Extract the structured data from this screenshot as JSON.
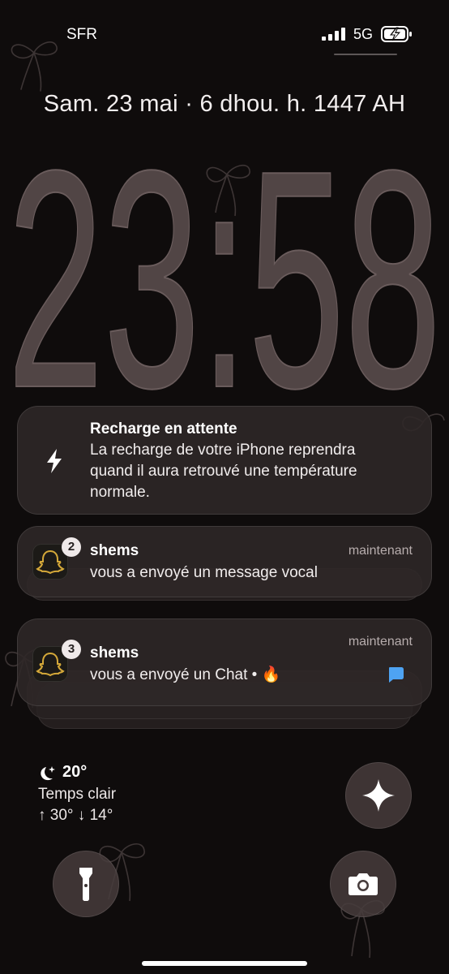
{
  "status_bar": {
    "carrier": "SFR",
    "network": "5G",
    "battery_state": "charging"
  },
  "lock": {
    "date": "Sam. 23 mai · 6 dhou. h. 1447 AH",
    "time": "23:58"
  },
  "notifications": [
    {
      "title": "Recharge en attente",
      "body_lines": [
        "La recharge de votre iPhone reprendra",
        "quand il aura retrouvé une température",
        "normale."
      ],
      "icon": "bolt-icon"
    },
    {
      "app_icon": "snapchat-icon",
      "badge": "2",
      "sender": "shems",
      "message": "vous a envoyé un message vocal",
      "time": "maintenant"
    },
    {
      "app_icon": "snapchat-icon",
      "badge": "3",
      "sender": "shems",
      "message": "vous a envoyé un Chat • 🔥",
      "time": "maintenant",
      "chat_icon_color": "#4ea3f2"
    }
  ],
  "weather": {
    "temp": "20°",
    "condition": "Temps clair",
    "range": "↑ 30° ↓ 14°",
    "icon": "moon-stars-icon"
  },
  "buttons": {
    "assistant": "sparkle-icon",
    "flashlight": "flashlight-icon",
    "camera": "camera-icon"
  },
  "colors": {
    "background": "#0f0c0c",
    "clock_fill": "#514545",
    "notification_bg": "#2f2828",
    "snap_accent": "#d4a839"
  }
}
